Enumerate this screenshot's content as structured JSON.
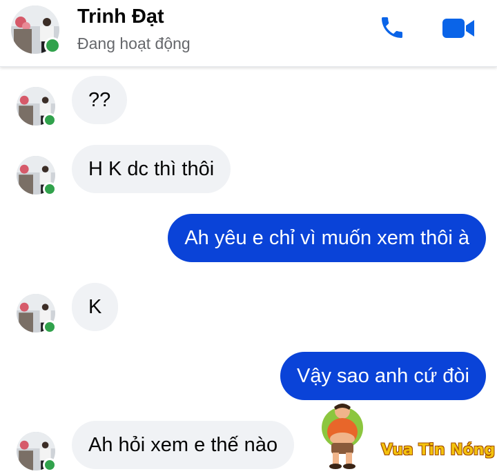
{
  "header": {
    "contact_name": "Trinh Đạt",
    "status": "Đang hoạt động",
    "call_icon": "phone-icon",
    "video_icon": "video-camera-icon"
  },
  "colors": {
    "accent": "#0a43d8",
    "online": "#31a24c",
    "incoming_bubble": "#f0f2f5",
    "icon": "#0a64e8"
  },
  "messages": [
    {
      "direction": "incoming",
      "text": "??"
    },
    {
      "direction": "incoming",
      "text": "H K dc thì thôi"
    },
    {
      "direction": "outgoing",
      "text": "Ah yêu e chỉ vì muốn xem thôi à"
    },
    {
      "direction": "incoming",
      "text": "K"
    },
    {
      "direction": "outgoing",
      "text": "Vậy sao anh cứ đòi"
    },
    {
      "direction": "incoming",
      "text": "Ah hỏi xem e thế nào"
    }
  ],
  "watermark": {
    "text": "Vua Tin Nóng"
  }
}
